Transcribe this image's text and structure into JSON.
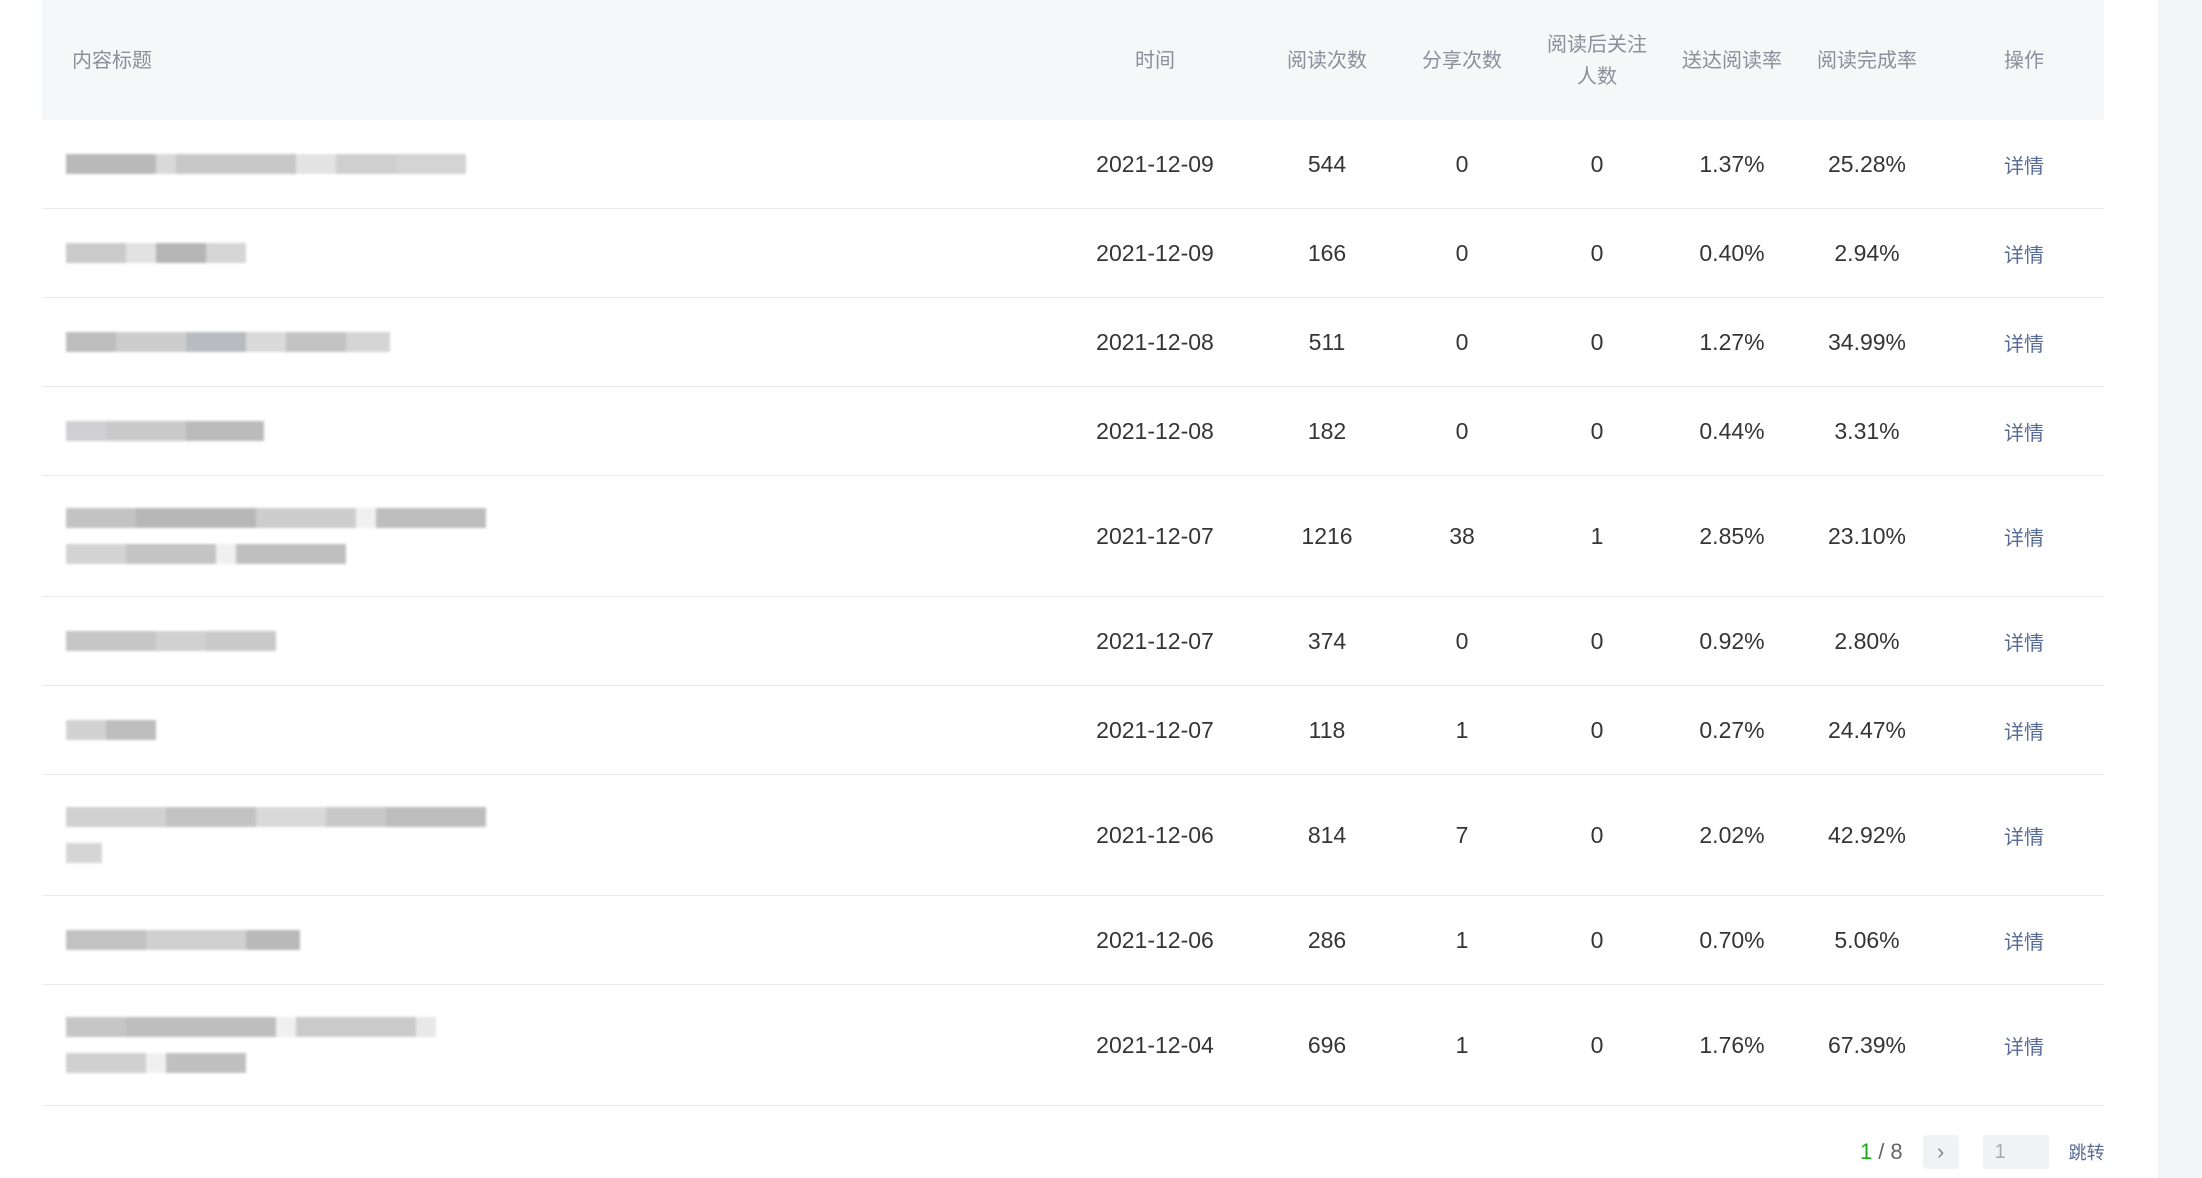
{
  "columns": {
    "title": "内容标题",
    "time": "时间",
    "reads": "阅读次数",
    "shares": "分享次数",
    "follows": "阅读后关注人数",
    "delivery_rate": "送达阅读率",
    "completion_rate": "阅读完成率",
    "action": "操作"
  },
  "rows": [
    {
      "time": "2021-12-09",
      "reads": "544",
      "shares": "0",
      "follows": "0",
      "delivery_rate": "1.37%",
      "completion_rate": "25.28%",
      "action": "详情"
    },
    {
      "time": "2021-12-09",
      "reads": "166",
      "shares": "0",
      "follows": "0",
      "delivery_rate": "0.40%",
      "completion_rate": "2.94%",
      "action": "详情"
    },
    {
      "time": "2021-12-08",
      "reads": "511",
      "shares": "0",
      "follows": "0",
      "delivery_rate": "1.27%",
      "completion_rate": "34.99%",
      "action": "详情"
    },
    {
      "time": "2021-12-08",
      "reads": "182",
      "shares": "0",
      "follows": "0",
      "delivery_rate": "0.44%",
      "completion_rate": "3.31%",
      "action": "详情"
    },
    {
      "time": "2021-12-07",
      "reads": "1216",
      "shares": "38",
      "follows": "1",
      "delivery_rate": "2.85%",
      "completion_rate": "23.10%",
      "action": "详情"
    },
    {
      "time": "2021-12-07",
      "reads": "374",
      "shares": "0",
      "follows": "0",
      "delivery_rate": "0.92%",
      "completion_rate": "2.80%",
      "action": "详情"
    },
    {
      "time": "2021-12-07",
      "reads": "118",
      "shares": "1",
      "follows": "0",
      "delivery_rate": "0.27%",
      "completion_rate": "24.47%",
      "action": "详情"
    },
    {
      "time": "2021-12-06",
      "reads": "814",
      "shares": "7",
      "follows": "0",
      "delivery_rate": "2.02%",
      "completion_rate": "42.92%",
      "action": "详情"
    },
    {
      "time": "2021-12-06",
      "reads": "286",
      "shares": "1",
      "follows": "0",
      "delivery_rate": "0.70%",
      "completion_rate": "5.06%",
      "action": "详情"
    },
    {
      "time": "2021-12-04",
      "reads": "696",
      "shares": "1",
      "follows": "0",
      "delivery_rate": "1.76%",
      "completion_rate": "67.39%",
      "action": "详情"
    }
  ],
  "pagination": {
    "current": "1",
    "separator": "/",
    "total": "8",
    "next_icon": "chevron-right-icon",
    "next_glyph": "›",
    "jump_value": "1",
    "jump_label": "跳转"
  },
  "colors": {
    "link": "#576b95",
    "accent": "#1aad19",
    "header_bg": "#f6f7f9"
  }
}
